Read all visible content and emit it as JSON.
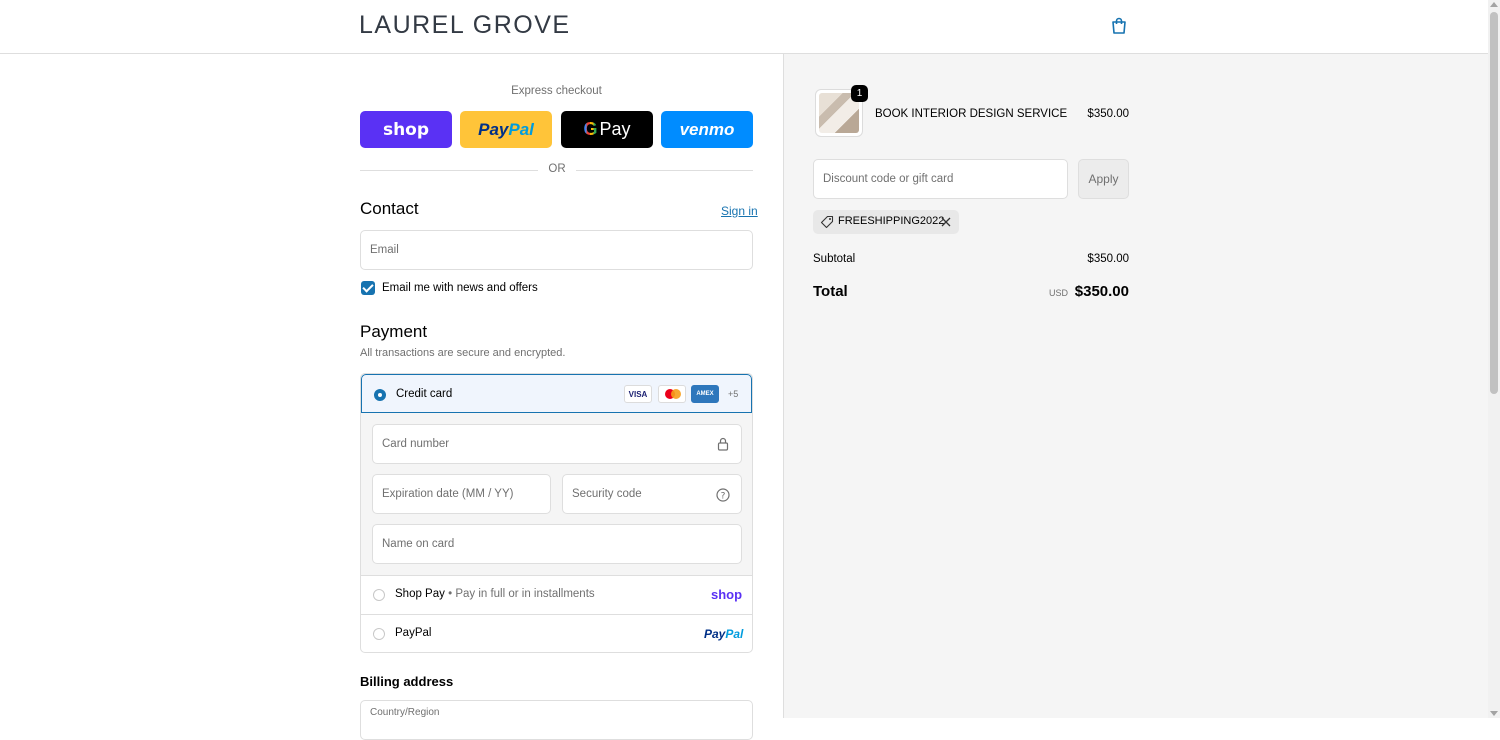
{
  "header": {
    "brand": "LAUREL GROVE",
    "cart_icon": "shopping-bag-icon"
  },
  "express": {
    "label": "Express checkout",
    "buttons": {
      "shop": "shop",
      "paypal_a": "Pay",
      "paypal_b": "Pal",
      "gpay_g": "G",
      "gpay_text": "Pay",
      "venmo": "venmo"
    },
    "or": "OR"
  },
  "contact": {
    "title": "Contact",
    "sign_in": "Sign in",
    "email_placeholder": "Email",
    "newsletter_label": "Email me with news and offers"
  },
  "payment": {
    "title": "Payment",
    "subtitle": "All transactions are secure and encrypted.",
    "credit_card": "Credit card",
    "card_badges": {
      "visa": "VISA",
      "amex": "AMEX",
      "more": "+5"
    },
    "card_number_placeholder": "Card number",
    "expiration_placeholder": "Expiration date (MM / YY)",
    "security_placeholder": "Security code",
    "name_placeholder": "Name on card",
    "shop_pay_label": "Shop Pay",
    "shop_pay_sep": "•",
    "shop_pay_desc": "Pay in full or in installments",
    "shop_pay_logo": "shop",
    "paypal_label": "PayPal",
    "paypal_logo_a": "Pay",
    "paypal_logo_b": "Pal"
  },
  "billing": {
    "title": "Billing address",
    "country_placeholder": "Country/Region"
  },
  "summary": {
    "item_name": "BOOK INTERIOR DESIGN SERVICE",
    "item_price": "$350.00",
    "item_qty": "1",
    "discount_placeholder": "Discount code or gift card",
    "apply": "Apply",
    "applied_code": "FREESHIPPING2022",
    "subtotal_label": "Subtotal",
    "subtotal_value": "$350.00",
    "total_label": "Total",
    "currency": "USD",
    "total_value": "$350.00"
  },
  "colors": {
    "accent": "#1773b0",
    "shop": "#5a31f4",
    "paypal_yellow": "#ffc439",
    "venmo": "#008cff",
    "panel_bg": "#f5f5f5"
  }
}
